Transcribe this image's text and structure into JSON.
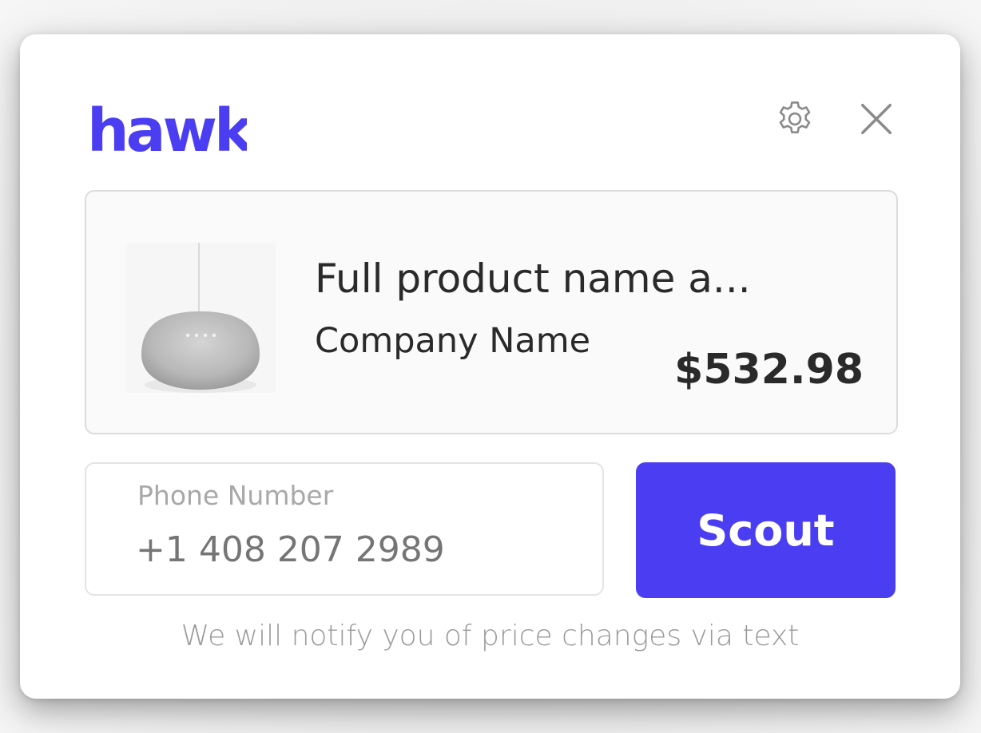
{
  "brand": {
    "logo_text": "hawk",
    "accent_color": "#4b3ef2"
  },
  "header": {
    "settings_icon": "gear-icon",
    "close_icon": "close-icon"
  },
  "product": {
    "name": "Full product name a...",
    "company": "Company Name",
    "price": "$532.98",
    "image_icon": "smart-speaker-image"
  },
  "phone": {
    "label": "Phone Number",
    "value": "+1 408 207 2989"
  },
  "actions": {
    "scout_label": "Scout"
  },
  "footer": {
    "notice": "We will notify you of price changes via text"
  }
}
